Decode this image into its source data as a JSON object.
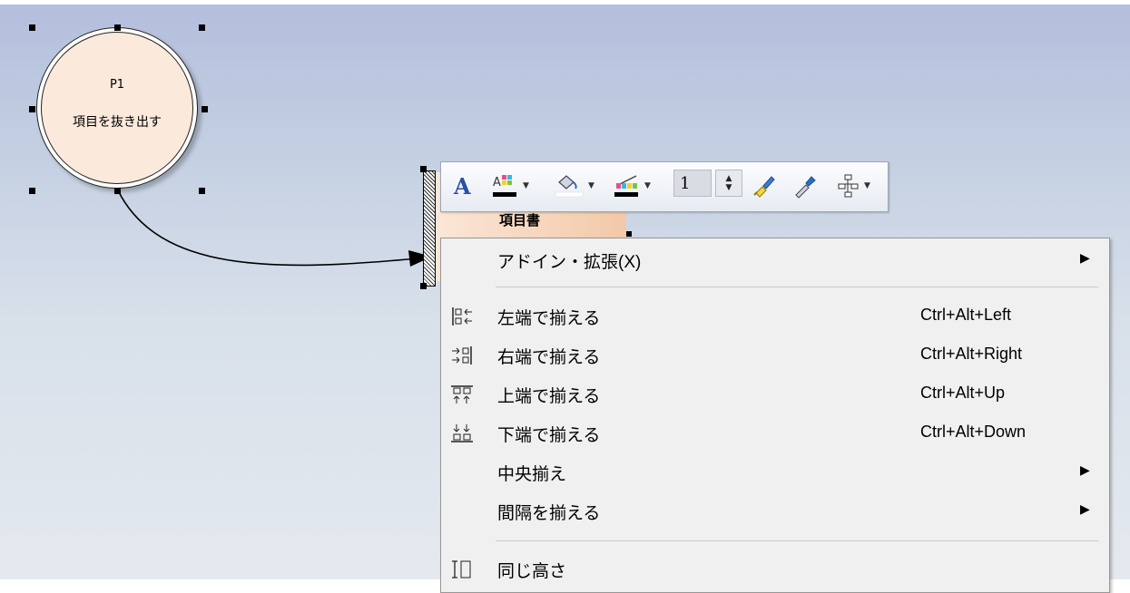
{
  "diagram": {
    "process": {
      "id": "P1",
      "name": "項目を抜き出す"
    },
    "datastore": {
      "label": "項目書"
    }
  },
  "toolbar": {
    "line_width_value": "1",
    "colors": {
      "font_fill": "#000000",
      "fill": "#ffffff",
      "line": "#000000",
      "accent_blue": "#2b4fa8"
    },
    "buttons": [
      {
        "name": "font-button",
        "icon": "A"
      },
      {
        "name": "font-color-button",
        "icon": "font-color-icon"
      },
      {
        "name": "fill-color-button",
        "icon": "paint-bucket-icon"
      },
      {
        "name": "line-color-button",
        "icon": "line-color-icon"
      },
      {
        "name": "line-width-spinner",
        "icon": "spinner-icon"
      },
      {
        "name": "format-painter-button",
        "icon": "paint-brush-icon"
      },
      {
        "name": "eyedropper-button",
        "icon": "eyedropper-icon"
      },
      {
        "name": "layout-button",
        "icon": "hierarchy-icon"
      }
    ]
  },
  "context_menu": {
    "items": [
      {
        "label": "アドイン・拡張(X)",
        "shortcut": "",
        "submenu": true,
        "icon": ""
      },
      {
        "label": "左端で揃える",
        "shortcut": "Ctrl+Alt+Left",
        "submenu": false,
        "icon": "align-left-icon"
      },
      {
        "label": "右端で揃える",
        "shortcut": "Ctrl+Alt+Right",
        "submenu": false,
        "icon": "align-right-icon"
      },
      {
        "label": "上端で揃える",
        "shortcut": "Ctrl+Alt+Up",
        "submenu": false,
        "icon": "align-top-icon"
      },
      {
        "label": "下端で揃える",
        "shortcut": "Ctrl+Alt+Down",
        "submenu": false,
        "icon": "align-bottom-icon"
      },
      {
        "label": "中央揃え",
        "shortcut": "",
        "submenu": true,
        "icon": ""
      },
      {
        "label": "間隔を揃える",
        "shortcut": "",
        "submenu": true,
        "icon": ""
      },
      {
        "label": "同じ高さ",
        "shortcut": "",
        "submenu": false,
        "icon": "same-height-icon"
      }
    ]
  }
}
